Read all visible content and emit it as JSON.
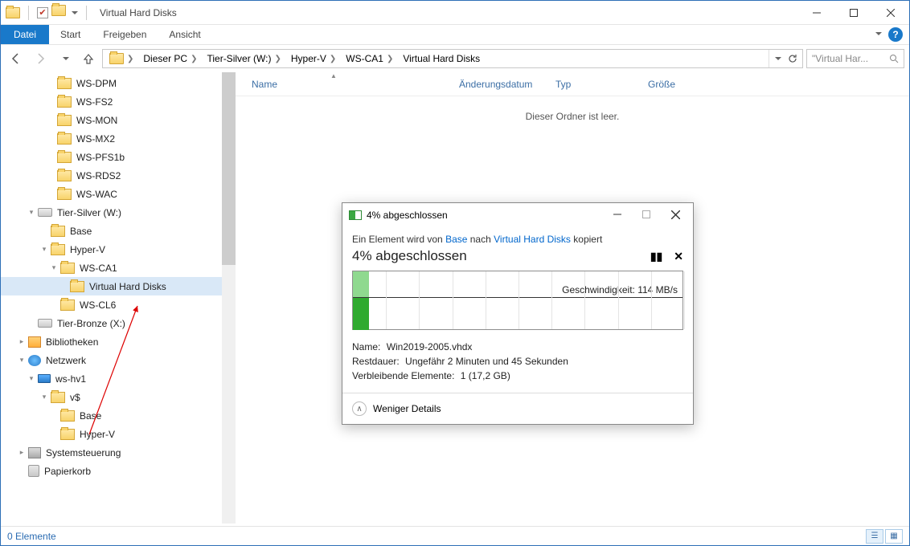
{
  "window": {
    "title": "Virtual Hard Disks"
  },
  "ribbon": {
    "file": "Datei",
    "tabs": [
      "Start",
      "Freigeben",
      "Ansicht"
    ]
  },
  "breadcrumb": {
    "segments": [
      "Dieser PC",
      "Tier-Silver (W:)",
      "Hyper-V",
      "WS-CA1",
      "Virtual Hard Disks"
    ]
  },
  "search": {
    "placeholder": "\"Virtual Har..."
  },
  "columns": {
    "name": "Name",
    "modified": "Änderungsdatum",
    "type": "Typ",
    "size": "Größe"
  },
  "content": {
    "empty": "Dieser Ordner ist leer."
  },
  "tree": [
    {
      "label": "WS-DPM",
      "icon": "folder",
      "indent": 56
    },
    {
      "label": "WS-FS2",
      "icon": "folder",
      "indent": 56
    },
    {
      "label": "WS-MON",
      "icon": "folder",
      "indent": 56
    },
    {
      "label": "WS-MX2",
      "icon": "folder",
      "indent": 56
    },
    {
      "label": "WS-PFS1b",
      "icon": "folder",
      "indent": 56
    },
    {
      "label": "WS-RDS2",
      "icon": "folder",
      "indent": 56
    },
    {
      "label": "WS-WAC",
      "icon": "folder",
      "indent": 56
    },
    {
      "label": "Tier-Silver (W:)",
      "icon": "drive",
      "indent": 32,
      "exp": "down"
    },
    {
      "label": "Base",
      "icon": "folder",
      "indent": 48
    },
    {
      "label": "Hyper-V",
      "icon": "folder",
      "indent": 48,
      "exp": "down"
    },
    {
      "label": "WS-CA1",
      "icon": "folder",
      "indent": 60,
      "exp": "down"
    },
    {
      "label": "Virtual Hard Disks",
      "icon": "folder",
      "indent": 72,
      "selected": true
    },
    {
      "label": "WS-CL6",
      "icon": "folder",
      "indent": 60
    },
    {
      "label": "Tier-Bronze (X:)",
      "icon": "drive",
      "indent": 32
    },
    {
      "label": "Bibliotheken",
      "icon": "libraries",
      "indent": 20,
      "exp": "right"
    },
    {
      "label": "Netzwerk",
      "icon": "network",
      "indent": 20,
      "exp": "down"
    },
    {
      "label": "ws-hv1",
      "icon": "computer",
      "indent": 32,
      "exp": "down"
    },
    {
      "label": "v$",
      "icon": "folder",
      "indent": 48,
      "exp": "down"
    },
    {
      "label": "Base",
      "icon": "folder",
      "indent": 60
    },
    {
      "label": "Hyper-V",
      "icon": "folder",
      "indent": 60
    },
    {
      "label": "Systemsteuerung",
      "icon": "cpanel",
      "indent": 20,
      "exp": "right"
    },
    {
      "label": "Papierkorb",
      "icon": "trash",
      "indent": 20
    }
  ],
  "status": {
    "items": "0 Elemente"
  },
  "dialog": {
    "title": "4% abgeschlossen",
    "msg_pre": "Ein Element wird von ",
    "msg_src": "Base",
    "msg_mid": " nach ",
    "msg_dst": "Virtual Hard Disks",
    "msg_post": " kopiert",
    "progress_title": "4% abgeschlossen",
    "speed_label": "Geschwindigkeit: 114 MB/s",
    "name_label": "Name:",
    "name_value": "Win2019-2005.vhdx",
    "time_label": "Restdauer:",
    "time_value": "Ungefähr 2 Minuten und 45 Sekunden",
    "remain_label": "Verbleibende Elemente:",
    "remain_value": "1 (17,2 GB)",
    "fewer": "Weniger Details"
  }
}
